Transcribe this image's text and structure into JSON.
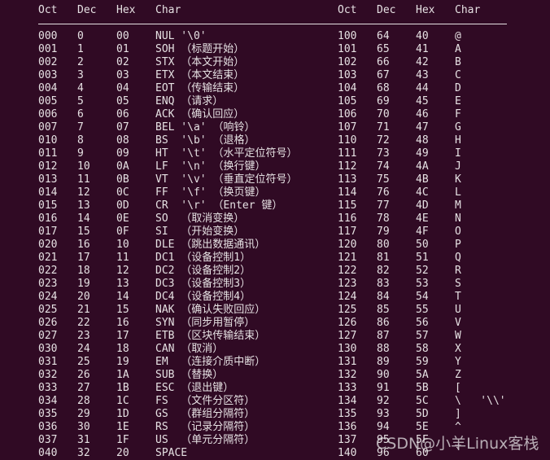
{
  "headers": [
    "Oct",
    "Dec",
    "Hex",
    "Char"
  ],
  "left_rows": [
    [
      "000",
      "0",
      "00",
      "NUL '\\0'"
    ],
    [
      "001",
      "1",
      "01",
      "SOH （标题开始）"
    ],
    [
      "002",
      "2",
      "02",
      "STX （本文开始）"
    ],
    [
      "003",
      "3",
      "03",
      "ETX （本文结束）"
    ],
    [
      "004",
      "4",
      "04",
      "EOT （传输结束）"
    ],
    [
      "005",
      "5",
      "05",
      "ENQ （请求）"
    ],
    [
      "006",
      "6",
      "06",
      "ACK （确认回应）"
    ],
    [
      "007",
      "7",
      "07",
      "BEL '\\a' （响铃）"
    ],
    [
      "010",
      "8",
      "08",
      "BS  '\\b' （退格）"
    ],
    [
      "011",
      "9",
      "09",
      "HT  '\\t' （水平定位符号）"
    ],
    [
      "012",
      "10",
      "0A",
      "LF  '\\n' （换行键）"
    ],
    [
      "013",
      "11",
      "0B",
      "VT  '\\v' （垂直定位符号）"
    ],
    [
      "014",
      "12",
      "0C",
      "FF  '\\f' （换页键）"
    ],
    [
      "015",
      "13",
      "0D",
      "CR  '\\r' （Enter 键）"
    ],
    [
      "016",
      "14",
      "0E",
      "SO  （取消变换）"
    ],
    [
      "017",
      "15",
      "0F",
      "SI  （开始变换）"
    ],
    [
      "020",
      "16",
      "10",
      "DLE （跳出数据通讯）"
    ],
    [
      "021",
      "17",
      "11",
      "DC1 （设备控制1）"
    ],
    [
      "022",
      "18",
      "12",
      "DC2 （设备控制2）"
    ],
    [
      "023",
      "19",
      "13",
      "DC3 （设备控制3）"
    ],
    [
      "024",
      "20",
      "14",
      "DC4 （设备控制4）"
    ],
    [
      "025",
      "21",
      "15",
      "NAK （确认失败回应）"
    ],
    [
      "026",
      "22",
      "16",
      "SYN （同步用暂停）"
    ],
    [
      "027",
      "23",
      "17",
      "ETB （区块传输结束）"
    ],
    [
      "030",
      "24",
      "18",
      "CAN （取消）"
    ],
    [
      "031",
      "25",
      "19",
      "EM  （连接介质中断）"
    ],
    [
      "032",
      "26",
      "1A",
      "SUB （替换）"
    ],
    [
      "033",
      "27",
      "1B",
      "ESC （退出键）"
    ],
    [
      "034",
      "28",
      "1C",
      "FS  （文件分区符）"
    ],
    [
      "035",
      "29",
      "1D",
      "GS  （群组分隔符）"
    ],
    [
      "036",
      "30",
      "1E",
      "RS  （记录分隔符）"
    ],
    [
      "037",
      "31",
      "1F",
      "US  （单元分隔符）"
    ],
    [
      "040",
      "32",
      "20",
      "SPACE"
    ]
  ],
  "right_rows": [
    [
      "100",
      "64",
      "40",
      "@"
    ],
    [
      "101",
      "65",
      "41",
      "A"
    ],
    [
      "102",
      "66",
      "42",
      "B"
    ],
    [
      "103",
      "67",
      "43",
      "C"
    ],
    [
      "104",
      "68",
      "44",
      "D"
    ],
    [
      "105",
      "69",
      "45",
      "E"
    ],
    [
      "106",
      "70",
      "46",
      "F"
    ],
    [
      "107",
      "71",
      "47",
      "G"
    ],
    [
      "110",
      "72",
      "48",
      "H"
    ],
    [
      "111",
      "73",
      "49",
      "I"
    ],
    [
      "112",
      "74",
      "4A",
      "J"
    ],
    [
      "113",
      "75",
      "4B",
      "K"
    ],
    [
      "114",
      "76",
      "4C",
      "L"
    ],
    [
      "115",
      "77",
      "4D",
      "M"
    ],
    [
      "116",
      "78",
      "4E",
      "N"
    ],
    [
      "117",
      "79",
      "4F",
      "O"
    ],
    [
      "120",
      "80",
      "50",
      "P"
    ],
    [
      "121",
      "81",
      "51",
      "Q"
    ],
    [
      "122",
      "82",
      "52",
      "R"
    ],
    [
      "123",
      "83",
      "53",
      "S"
    ],
    [
      "124",
      "84",
      "54",
      "T"
    ],
    [
      "125",
      "85",
      "55",
      "U"
    ],
    [
      "126",
      "86",
      "56",
      "V"
    ],
    [
      "127",
      "87",
      "57",
      "W"
    ],
    [
      "130",
      "88",
      "58",
      "X"
    ],
    [
      "131",
      "89",
      "59",
      "Y"
    ],
    [
      "132",
      "90",
      "5A",
      "Z"
    ],
    [
      "133",
      "91",
      "5B",
      "["
    ],
    [
      "134",
      "92",
      "5C",
      "\\   '\\\\'"
    ],
    [
      "135",
      "93",
      "5D",
      "]"
    ],
    [
      "136",
      "94",
      "5E",
      "^"
    ],
    [
      "137",
      "95",
      "5F",
      "_"
    ],
    [
      "140",
      "96",
      "60",
      "`"
    ]
  ],
  "watermark": "CSDN@小羊Linux客栈",
  "colors": {
    "background": "#300a24",
    "text": "#e6e1e3"
  }
}
